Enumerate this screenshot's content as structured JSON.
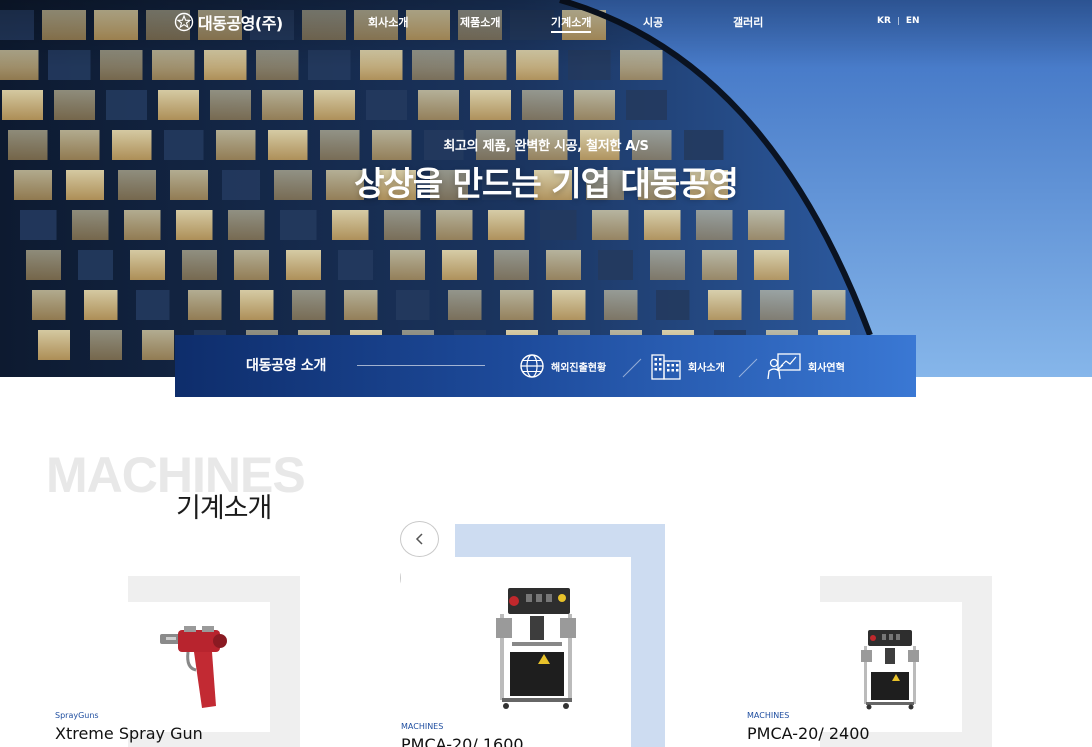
{
  "header": {
    "logo_text": "대동공영(주)",
    "menu": [
      {
        "label": "회사소개"
      },
      {
        "label": "제품소개"
      },
      {
        "label": "기계소개"
      },
      {
        "label": "시공"
      },
      {
        "label": "갤러리"
      }
    ],
    "lang": {
      "kr": "KR",
      "en": "EN"
    }
  },
  "hero": {
    "subtitle": "최고의 제품, 완벽한 시공, 철저한 A/S",
    "title": "상상을 만드는 기업 대동공영"
  },
  "intro_bar": {
    "title": "대동공영 소개",
    "links": [
      {
        "label": "해외진출현황",
        "icon": "globe-icon"
      },
      {
        "label": "회사소개",
        "icon": "building-icon"
      },
      {
        "label": "회사연혁",
        "icon": "presentation-icon"
      }
    ]
  },
  "machines": {
    "bg_word": "MACHINES",
    "title": "기계소개",
    "items": [
      {
        "category": "SprayGuns",
        "name": "Xtreme Spray Gun"
      },
      {
        "category": "MACHINES",
        "name": "PMCA-20/ 1600"
      },
      {
        "category": "MACHINES",
        "name": "PMCA-20/ 2400"
      }
    ],
    "prev_icon": "chevron-left-icon",
    "next_icon": "chevron-right-icon"
  },
  "colors": {
    "brand_navy": "#0e2d6b",
    "brand_blue": "#3a78d4",
    "card_highlight": "#cddcf1",
    "card_frame": "#efefef"
  }
}
